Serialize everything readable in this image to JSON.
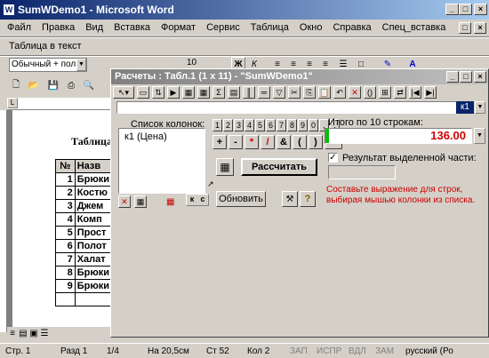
{
  "app": {
    "title": "SumWDemo1 - Microsoft Word"
  },
  "menu": [
    "Файл",
    "Правка",
    "Вид",
    "Вставка",
    "Формат",
    "Сервис",
    "Таблица",
    "Окно",
    "Справка",
    "Спец_вставка"
  ],
  "toolbar_label": "Таблица в текст",
  "format_bar": {
    "style": "Обычный + пол",
    "size": "10"
  },
  "document": {
    "heading": "Таблица",
    "table": {
      "headers": [
        "№",
        "Назв"
      ],
      "rows": [
        [
          "1",
          "Брюки"
        ],
        [
          "2",
          "Костю"
        ],
        [
          "3",
          "Джем"
        ],
        [
          "4",
          "Комп"
        ],
        [
          "5",
          "Прост"
        ],
        [
          "6",
          "Полот"
        ],
        [
          "7",
          "Халат"
        ],
        [
          "8",
          "Брюки"
        ],
        [
          "9",
          "Брюки"
        ]
      ]
    }
  },
  "dialog": {
    "title": "Расчеты :  Табл.1 (1 x 11) - \"SumWDemo1\"",
    "expression_value": "",
    "cell_ref": "к1",
    "columns_label": "Список колонок:",
    "columns": [
      "к1  (Цена)"
    ],
    "digit_buttons": [
      "1",
      "2",
      "3",
      "4",
      "5",
      "6",
      "7",
      "8",
      "9",
      "0",
      ",",
      "."
    ],
    "op_buttons": [
      "+",
      "-",
      "*",
      "/",
      "&",
      "(",
      ")",
      ">>"
    ],
    "calc_button": "Рассчитать",
    "refresh_button": "Обновить",
    "k_label": "к",
    "c_label": "с",
    "total_label": "Итого по 10 строкам:",
    "total_value": "136.00",
    "selection_label": "Результат выделенной части:",
    "selection_value": "",
    "hint": "Составьте выражение для строк, выбирая мышью колонки из списка."
  },
  "statusbar": [
    "Стр. 1",
    "Разд 1",
    "1/4",
    "На 20,5см",
    "Ст 52",
    "Кол 2",
    "ЗАП",
    "ИСПР",
    "ВДЛ",
    "ЗАМ",
    "русский (Ро"
  ],
  "colors": {
    "title": "#0a246a",
    "accent_red": "#c00000",
    "link_blue": "#0000cc"
  }
}
